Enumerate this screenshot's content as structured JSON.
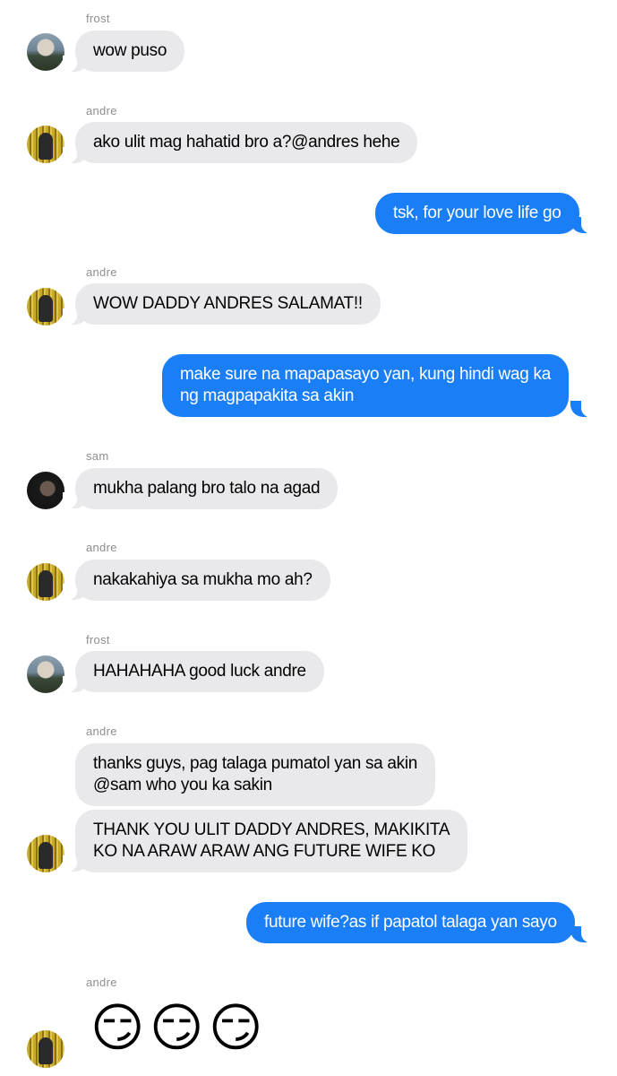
{
  "messages": [
    {
      "sender": "frost",
      "text": "wow puso"
    },
    {
      "sender": "andre",
      "text": "ako ulit mag hahatid bro a?@andres hehe"
    },
    {
      "sender": "me",
      "text": "tsk, for your love life go"
    },
    {
      "sender": "andre",
      "text": "WOW DADDY ANDRES SALAMAT!!"
    },
    {
      "sender": "me",
      "lines": [
        "make sure na mapapasayo yan, kung hindi wag ka",
        "ng magpapakita sa akin"
      ]
    },
    {
      "sender": "sam",
      "text": "mukha palang bro talo na agad"
    },
    {
      "sender": "andre",
      "text": "nakakahiya sa mukha mo ah?"
    },
    {
      "sender": "frost",
      "text": "HAHAHAHA good luck andre"
    },
    {
      "sender": "andre",
      "lines": [
        "thanks guys, pag talaga pumatol yan sa akin",
        "@sam who you ka sakin"
      ]
    },
    {
      "sender": "andre",
      "lines": [
        "THANK YOU ULIT DADDY ANDRES, MAKIKITA",
        "KO NA ARAW ARAW ANG FUTURE WIFE KO"
      ]
    },
    {
      "sender": "me",
      "text": "future wife?as if papatol talaga yan sayo"
    },
    {
      "sender": "andre",
      "emojis": [
        "😏",
        "😏",
        "😏"
      ]
    }
  ]
}
